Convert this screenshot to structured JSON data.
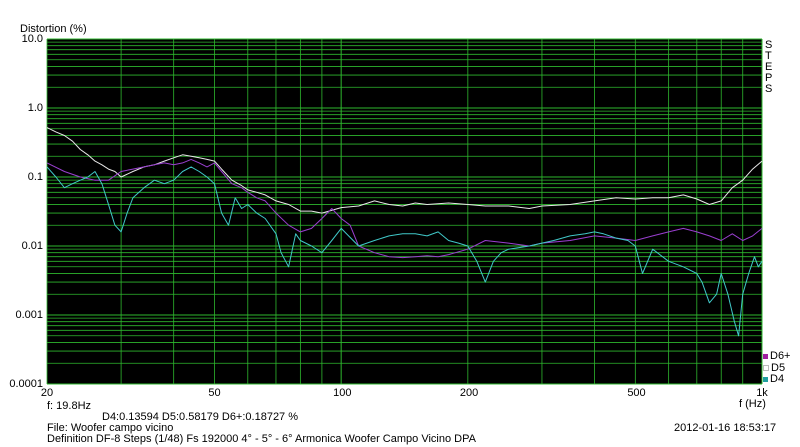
{
  "chart_data": {
    "type": "line",
    "ylabel": "Distortion (%)",
    "xlabel": "f (Hz)",
    "x_scale": "log",
    "y_scale": "log",
    "xlim": [
      20,
      1000
    ],
    "ylim": [
      0.0001,
      10
    ],
    "x_ticks": [
      {
        "value": 20,
        "label": "20"
      },
      {
        "value": 50,
        "label": "50"
      },
      {
        "value": 100,
        "label": "100"
      },
      {
        "value": 200,
        "label": "200"
      },
      {
        "value": 500,
        "label": "500"
      },
      {
        "value": 1000,
        "label": "1k"
      }
    ],
    "y_ticks": [
      {
        "value": 10,
        "label": "10.0"
      },
      {
        "value": 1,
        "label": "1.0"
      },
      {
        "value": 0.1,
        "label": "0.1"
      },
      {
        "value": 0.01,
        "label": "0.01"
      },
      {
        "value": 0.001,
        "label": "0.001"
      },
      {
        "value": 0.0001,
        "label": "0.0001"
      }
    ],
    "grid": true,
    "background": "#000000",
    "grid_color": "#2eb82e",
    "legend_position": "bottom-right",
    "series": [
      {
        "name": "D5",
        "color": "#e8e8e8",
        "points": [
          [
            20,
            0.52
          ],
          [
            21,
            0.45
          ],
          [
            22,
            0.4
          ],
          [
            23,
            0.33
          ],
          [
            24,
            0.25
          ],
          [
            25,
            0.21
          ],
          [
            26,
            0.17
          ],
          [
            27,
            0.15
          ],
          [
            28,
            0.13
          ],
          [
            29,
            0.12
          ],
          [
            30,
            0.1
          ],
          [
            32,
            0.12
          ],
          [
            34,
            0.14
          ],
          [
            36,
            0.15
          ],
          [
            38,
            0.17
          ],
          [
            40,
            0.19
          ],
          [
            42,
            0.21
          ],
          [
            44,
            0.2
          ],
          [
            46,
            0.19
          ],
          [
            48,
            0.18
          ],
          [
            50,
            0.17
          ],
          [
            52,
            0.13
          ],
          [
            55,
            0.09
          ],
          [
            58,
            0.075
          ],
          [
            60,
            0.065
          ],
          [
            63,
            0.06
          ],
          [
            66,
            0.055
          ],
          [
            70,
            0.045
          ],
          [
            75,
            0.04
          ],
          [
            80,
            0.032
          ],
          [
            85,
            0.032
          ],
          [
            90,
            0.03
          ],
          [
            100,
            0.036
          ],
          [
            110,
            0.038
          ],
          [
            120,
            0.045
          ],
          [
            130,
            0.04
          ],
          [
            140,
            0.038
          ],
          [
            150,
            0.042
          ],
          [
            160,
            0.04
          ],
          [
            180,
            0.042
          ],
          [
            200,
            0.04
          ],
          [
            220,
            0.038
          ],
          [
            250,
            0.038
          ],
          [
            280,
            0.035
          ],
          [
            300,
            0.038
          ],
          [
            350,
            0.04
          ],
          [
            400,
            0.045
          ],
          [
            450,
            0.05
          ],
          [
            500,
            0.048
          ],
          [
            550,
            0.05
          ],
          [
            600,
            0.05
          ],
          [
            650,
            0.055
          ],
          [
            700,
            0.048
          ],
          [
            750,
            0.04
          ],
          [
            800,
            0.045
          ],
          [
            850,
            0.07
          ],
          [
            900,
            0.09
          ],
          [
            950,
            0.13
          ],
          [
            1000,
            0.17
          ]
        ]
      },
      {
        "name": "D6+",
        "color": "#9a3fd0",
        "points": [
          [
            20,
            0.16
          ],
          [
            22,
            0.12
          ],
          [
            24,
            0.1
          ],
          [
            26,
            0.09
          ],
          [
            28,
            0.09
          ],
          [
            30,
            0.12
          ],
          [
            32,
            0.13
          ],
          [
            34,
            0.14
          ],
          [
            36,
            0.15
          ],
          [
            38,
            0.16
          ],
          [
            40,
            0.15
          ],
          [
            42,
            0.16
          ],
          [
            44,
            0.18
          ],
          [
            46,
            0.16
          ],
          [
            48,
            0.14
          ],
          [
            50,
            0.16
          ],
          [
            52,
            0.12
          ],
          [
            55,
            0.08
          ],
          [
            58,
            0.07
          ],
          [
            60,
            0.06
          ],
          [
            63,
            0.05
          ],
          [
            66,
            0.045
          ],
          [
            70,
            0.03
          ],
          [
            75,
            0.02
          ],
          [
            80,
            0.016
          ],
          [
            85,
            0.018
          ],
          [
            90,
            0.025
          ],
          [
            95,
            0.035
          ],
          [
            100,
            0.025
          ],
          [
            105,
            0.02
          ],
          [
            110,
            0.01
          ],
          [
            120,
            0.008
          ],
          [
            130,
            0.007
          ],
          [
            140,
            0.0068
          ],
          [
            150,
            0.007
          ],
          [
            160,
            0.0072
          ],
          [
            170,
            0.007
          ],
          [
            180,
            0.0075
          ],
          [
            200,
            0.009
          ],
          [
            220,
            0.012
          ],
          [
            250,
            0.011
          ],
          [
            280,
            0.01
          ],
          [
            300,
            0.011
          ],
          [
            350,
            0.012
          ],
          [
            400,
            0.014
          ],
          [
            450,
            0.013
          ],
          [
            500,
            0.012
          ],
          [
            550,
            0.014
          ],
          [
            600,
            0.016
          ],
          [
            650,
            0.018
          ],
          [
            700,
            0.016
          ],
          [
            750,
            0.014
          ],
          [
            800,
            0.012
          ],
          [
            850,
            0.015
          ],
          [
            900,
            0.012
          ],
          [
            950,
            0.014
          ],
          [
            1000,
            0.018
          ]
        ]
      },
      {
        "name": "D4",
        "color": "#40c8c8",
        "points": [
          [
            20,
            0.14
          ],
          [
            21,
            0.1
          ],
          [
            22,
            0.07
          ],
          [
            23,
            0.08
          ],
          [
            24,
            0.09
          ],
          [
            25,
            0.1
          ],
          [
            26,
            0.12
          ],
          [
            27,
            0.08
          ],
          [
            28,
            0.04
          ],
          [
            29,
            0.02
          ],
          [
            30,
            0.016
          ],
          [
            31,
            0.03
          ],
          [
            32,
            0.05
          ],
          [
            34,
            0.07
          ],
          [
            36,
            0.09
          ],
          [
            38,
            0.08
          ],
          [
            40,
            0.09
          ],
          [
            42,
            0.12
          ],
          [
            44,
            0.14
          ],
          [
            46,
            0.12
          ],
          [
            48,
            0.1
          ],
          [
            50,
            0.08
          ],
          [
            52,
            0.03
          ],
          [
            54,
            0.02
          ],
          [
            56,
            0.05
          ],
          [
            58,
            0.035
          ],
          [
            60,
            0.04
          ],
          [
            63,
            0.03
          ],
          [
            66,
            0.025
          ],
          [
            70,
            0.015
          ],
          [
            72,
            0.008
          ],
          [
            75,
            0.005
          ],
          [
            78,
            0.015
          ],
          [
            80,
            0.012
          ],
          [
            85,
            0.01
          ],
          [
            90,
            0.008
          ],
          [
            95,
            0.012
          ],
          [
            100,
            0.018
          ],
          [
            110,
            0.01
          ],
          [
            120,
            0.012
          ],
          [
            130,
            0.014
          ],
          [
            140,
            0.015
          ],
          [
            150,
            0.015
          ],
          [
            160,
            0.014
          ],
          [
            170,
            0.016
          ],
          [
            180,
            0.012
          ],
          [
            190,
            0.011
          ],
          [
            200,
            0.01
          ],
          [
            210,
            0.006
          ],
          [
            220,
            0.003
          ],
          [
            230,
            0.006
          ],
          [
            240,
            0.008
          ],
          [
            250,
            0.009
          ],
          [
            280,
            0.01
          ],
          [
            300,
            0.011
          ],
          [
            320,
            0.012
          ],
          [
            350,
            0.014
          ],
          [
            380,
            0.015
          ],
          [
            400,
            0.016
          ],
          [
            420,
            0.015
          ],
          [
            450,
            0.013
          ],
          [
            480,
            0.012
          ],
          [
            500,
            0.01
          ],
          [
            520,
            0.004
          ],
          [
            550,
            0.009
          ],
          [
            600,
            0.006
          ],
          [
            650,
            0.005
          ],
          [
            700,
            0.004
          ],
          [
            720,
            0.003
          ],
          [
            750,
            0.0015
          ],
          [
            780,
            0.002
          ],
          [
            800,
            0.004
          ],
          [
            830,
            0.002
          ],
          [
            860,
            0.0008
          ],
          [
            880,
            0.0005
          ],
          [
            900,
            0.002
          ],
          [
            930,
            0.004
          ],
          [
            960,
            0.007
          ],
          [
            980,
            0.005
          ],
          [
            1000,
            0.006
          ]
        ]
      }
    ]
  },
  "side_label": [
    "S",
    "T",
    "E",
    "P",
    "S"
  ],
  "readout": {
    "freq": "f: 19.8Hz",
    "values": "D4:0.13594  D5:0.58179  D6+:0.18727 %"
  },
  "footer": {
    "file": "File: Woofer campo vicino",
    "definition": "Definition DF-8 Steps (1/48) Fs 192000 4° - 5° - 6° Armonica Woofer Campo Vicino     DPA",
    "timestamp": "2012-01-16 18:53:17"
  }
}
